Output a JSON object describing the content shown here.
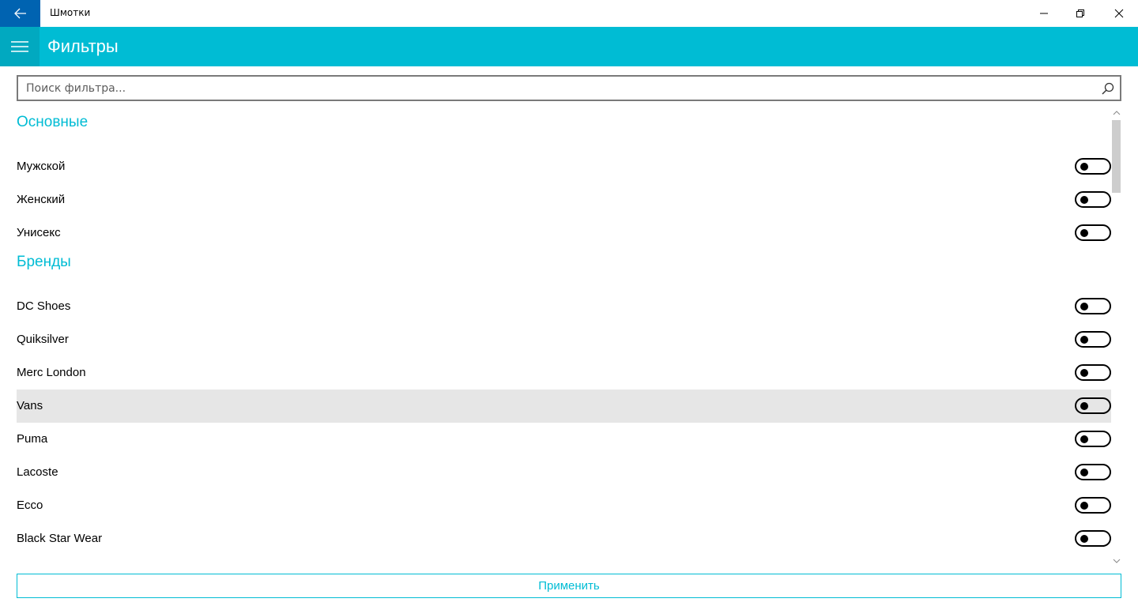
{
  "window": {
    "title": "Шмотки",
    "back_icon": "arrow-left-icon",
    "controls": [
      "minimize-icon",
      "restore-icon",
      "close-icon"
    ]
  },
  "header": {
    "menu_icon": "hamburger-icon",
    "title": "Фильтры",
    "color": "#00bcd4"
  },
  "search": {
    "value": "",
    "placeholder": "Поиск фильтра...",
    "icon": "search-icon"
  },
  "sections": [
    {
      "title": "Основные",
      "items": [
        {
          "label": "Мужской",
          "on": false
        },
        {
          "label": "Женский",
          "on": false
        },
        {
          "label": "Унисекс",
          "on": false
        }
      ]
    },
    {
      "title": "Бренды",
      "items": [
        {
          "label": "DC Shoes",
          "on": false
        },
        {
          "label": "Quiksilver",
          "on": false
        },
        {
          "label": "Merc London",
          "on": false
        },
        {
          "label": "Vans",
          "on": false,
          "hovered": true
        },
        {
          "label": "Puma",
          "on": false
        },
        {
          "label": "Lacoste",
          "on": false
        },
        {
          "label": "Ecco",
          "on": false
        },
        {
          "label": "Black Star Wear",
          "on": false
        }
      ]
    }
  ],
  "apply_button": {
    "label": "Применить"
  }
}
